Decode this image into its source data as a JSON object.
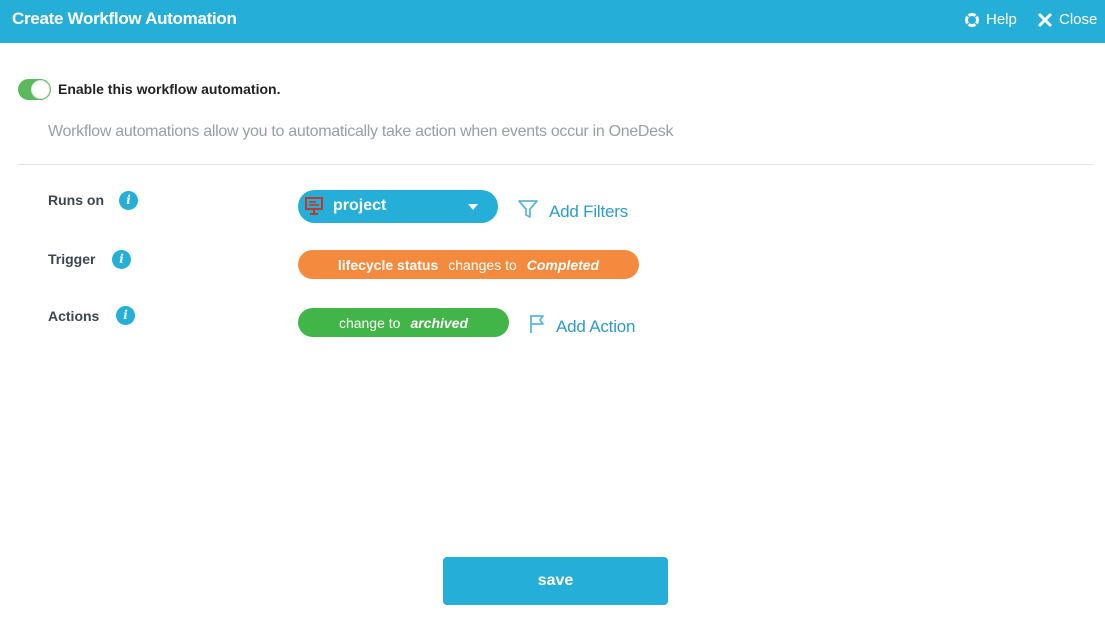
{
  "header": {
    "title": "Create Workflow Automation",
    "help_label": "Help",
    "close_label": "Close"
  },
  "toggle": {
    "enabled": true,
    "label": "Enable this workflow automation."
  },
  "description": "Workflow automations allow you to automatically take action when events occur in OneDesk",
  "rows": {
    "runs_on": {
      "label": "Runs on",
      "selected": "project",
      "add_filters_label": "Add Filters"
    },
    "trigger": {
      "label": "Trigger",
      "field": "lifecycle status",
      "verb": "changes to",
      "value": "Completed"
    },
    "actions": {
      "label": "Actions",
      "verb": "change to",
      "value": "archived",
      "add_action_label": "Add Action"
    }
  },
  "save_label": "save",
  "colors": {
    "primary": "#25aed8",
    "trigger": "#f48a3d",
    "action": "#42b549",
    "toggle_on": "#5cb85c",
    "project_icon": "#c0392b"
  }
}
